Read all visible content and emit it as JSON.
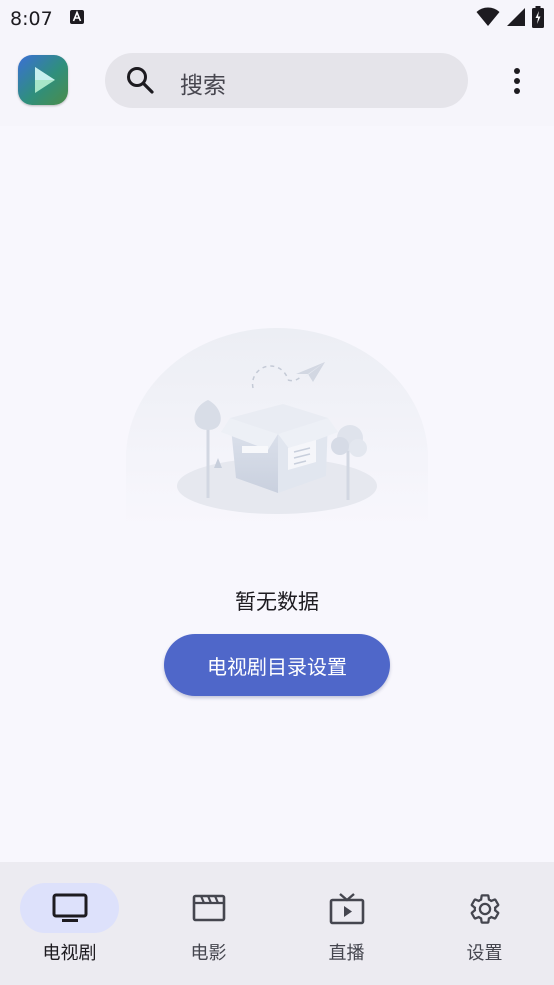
{
  "status_bar": {
    "time": "8:07",
    "notification_icon": "a-notification-icon",
    "wifi_icon": "wifi-icon",
    "signal_icon": "signal-icon",
    "battery_icon": "battery-charging-icon"
  },
  "header": {
    "logo_icon": "play-logo-icon",
    "search": {
      "placeholder": "搜索",
      "icon": "search-icon"
    },
    "more_icon": "more-vert-icon"
  },
  "empty_state": {
    "illustration": "empty-box-illustration",
    "message": "暂无数据",
    "action_label": "电视剧目录设置"
  },
  "bottom_nav": {
    "items": [
      {
        "label": "电视剧",
        "icon": "tv-icon",
        "active": true
      },
      {
        "label": "电影",
        "icon": "movie-clapper-icon",
        "active": false
      },
      {
        "label": "直播",
        "icon": "live-tv-icon",
        "active": false
      },
      {
        "label": "设置",
        "icon": "gear-icon",
        "active": false
      }
    ]
  },
  "colors": {
    "primary": "#4f67c9",
    "background": "#f8f7fd",
    "search_background": "#e5e4ea",
    "nav_background": "#ecebf1",
    "nav_active_pill": "#dde1fb"
  }
}
